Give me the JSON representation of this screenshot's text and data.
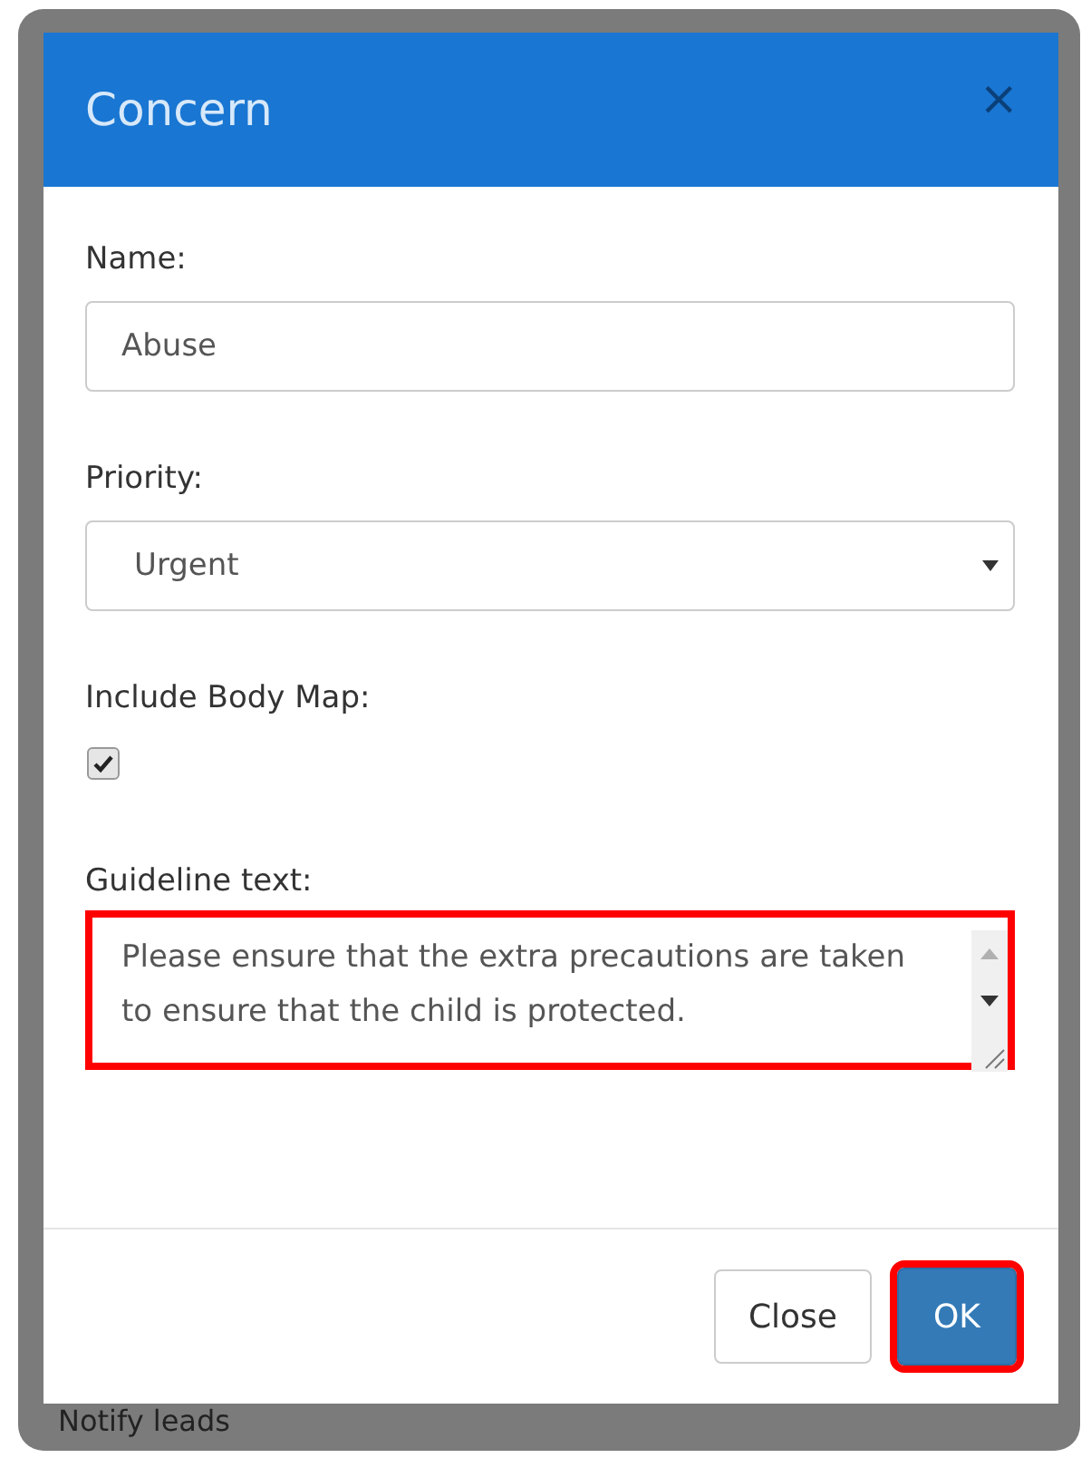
{
  "dialog": {
    "title": "Concern",
    "close_icon": "×"
  },
  "fields": [
    {
      "kind": "text",
      "label": "Name:",
      "value": "Abuse"
    },
    {
      "kind": "select",
      "label": "Priority:",
      "value": "Urgent"
    },
    {
      "kind": "checkbox",
      "label": "Include Body Map:",
      "checked": true
    },
    {
      "kind": "textarea",
      "label": "Guideline text:",
      "value": "Please ensure that the extra precautions are taken to ensure that the child is protected.",
      "highlighted": true
    }
  ],
  "buttons": [
    {
      "label": "Close",
      "kind": "default",
      "highlighted": false
    },
    {
      "label": "OK",
      "kind": "primary",
      "highlighted": true
    }
  ],
  "background_text": "Notify leads"
}
